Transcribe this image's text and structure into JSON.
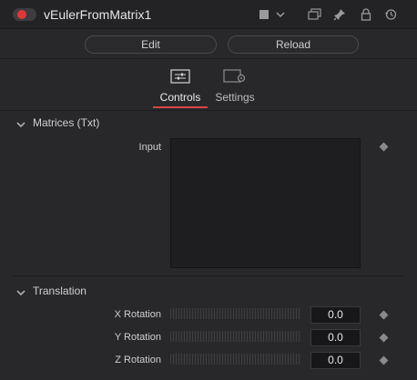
{
  "header": {
    "title": "vEulerFromMatrix1",
    "icons": [
      "toggle-switch",
      "color-square",
      "chevron-down",
      "window-copy",
      "pin",
      "lock",
      "reset-clock"
    ]
  },
  "buttons": {
    "edit": "Edit",
    "reload": "Reload"
  },
  "tabs": [
    {
      "label": "Controls",
      "icon": "sliders-icon",
      "active": true
    },
    {
      "label": "Settings",
      "icon": "gear-panel-icon",
      "active": false
    }
  ],
  "sections": {
    "matrices": {
      "title": "Matrices (Txt)",
      "input_label": "Input"
    },
    "translation": {
      "title": "Translation",
      "rows": [
        {
          "label": "X Rotation",
          "value": "0.0"
        },
        {
          "label": "Y Rotation",
          "value": "0.0"
        },
        {
          "label": "Z Rotation",
          "value": "0.0"
        }
      ]
    }
  },
  "colors": {
    "accent": "#d8453f",
    "toggle_on": "#e0373a"
  }
}
